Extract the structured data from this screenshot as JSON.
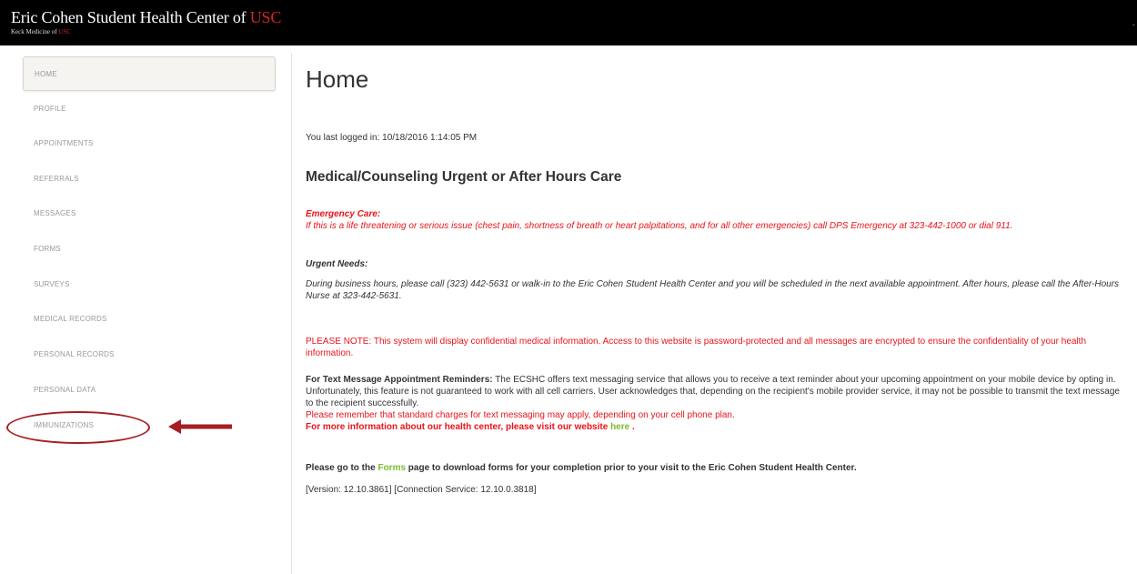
{
  "header": {
    "brand_main": "Eric Cohen Student Health Center of ",
    "brand_accent": "USC",
    "sub_main": "Keck Medicine of ",
    "sub_accent": "USC",
    "edge_mark": "-"
  },
  "sidebar": {
    "items": [
      {
        "label": "HOME",
        "active": true
      },
      {
        "label": "PROFILE",
        "active": false
      },
      {
        "label": "APPOINTMENTS",
        "active": false
      },
      {
        "label": "REFERRALS",
        "active": false
      },
      {
        "label": "MESSAGES",
        "active": false
      },
      {
        "label": "FORMS",
        "active": false
      },
      {
        "label": "SURVEYS",
        "active": false
      },
      {
        "label": "MEDICAL RECORDS",
        "active": false
      },
      {
        "label": "PERSONAL RECORDS",
        "active": false
      },
      {
        "label": "PERSONAL DATA",
        "active": false
      },
      {
        "label": "IMMUNIZATIONS",
        "active": false
      }
    ]
  },
  "annotation": {
    "color": "#a61e22",
    "circle_icon": "ellipse-highlight",
    "arrow_icon": "arrow-left-icon"
  },
  "main": {
    "title": "Home",
    "last_login": "You last logged in: 10/18/2016 1:14:05 PM",
    "section_title": "Medical/Counseling Urgent or After Hours Care",
    "emergency_heading": "Emergency Care:",
    "emergency_text": "If this is a life threatening or serious issue (chest pain, shortness of breath or heart palpitations, and for all other emergencies) call DPS Emergency at 323-442-1000 or dial 911.",
    "urgent_heading": "Urgent Needs:",
    "urgent_text": "During business hours, please call (323) 442-5631 or walk-in to the Eric Cohen Student Health Center and you will be scheduled in the next available appointment. After hours, please call the After-Hours Nurse at 323-442-5631.",
    "please_note": "PLEASE NOTE: This system will display confidential medical information. Access to this website is password-protected and all messages are encrypted to ensure the confidentiality of your health information.",
    "sms_label": "For Text Message Appointment Reminders:",
    "sms_text": " The ECSHC offers text messaging service that allows you to receive a text reminder about your upcoming appointment on your mobile device by opting in. Unfortunately, this feature is not guaranteed to work with all cell carriers. User acknowledges that, depending on the recipient's mobile provider service, it may not be possible to transmit the text message to the recipient successfully.",
    "sms_charges": "Please remember that standard charges for text messaging may apply, depending on your cell phone plan.",
    "more_info_prefix": "For more information about our health center, please visit our website ",
    "more_info_link": "here",
    "more_info_suffix": " .",
    "forms_prefix": "Please go to the ",
    "forms_link": "Forms",
    "forms_suffix": " page to download forms for your completion prior to your visit to the Eric Cohen Student Health Center.",
    "version": "[Version: 12.10.3861]  [Connection Service: 12.10.0.3818]"
  },
  "colors": {
    "header_bg": "#000000",
    "accent_red": "#d32626",
    "alert_red": "#e8141a",
    "link_green": "#7dbb2f",
    "nav_text": "#999999"
  }
}
